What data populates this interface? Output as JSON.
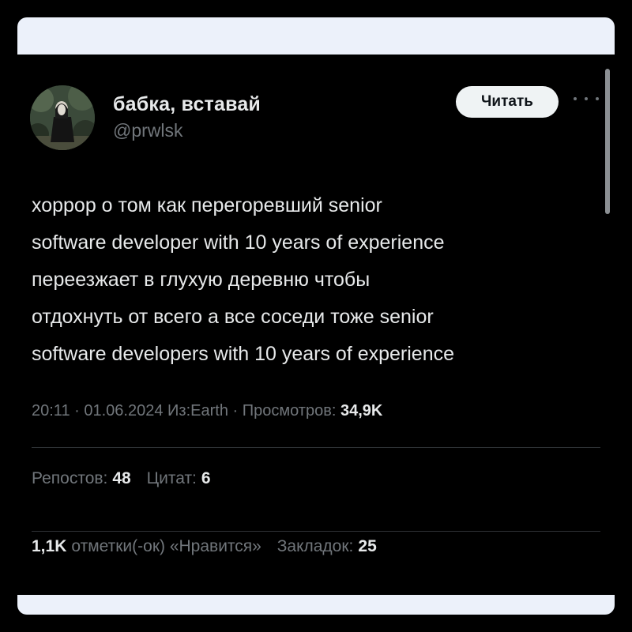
{
  "author": {
    "display_name": "бабка, вставай",
    "handle": "@prwlsk"
  },
  "follow_button": {
    "label": "Читать"
  },
  "tweet": {
    "text": "хоррор о том как перегоревший senior\nsoftware developer with 10 years of experience\nпереезжает в глухую деревню чтобы\nотдохнуть от всего а все соседи тоже senior\nsoftware developers with 10 years of experience"
  },
  "meta": {
    "time": "20:11",
    "date": "01.06.2024",
    "source": "Из:Earth",
    "views_label": "Просмотров:",
    "views_value": "34,9K",
    "separator": "·"
  },
  "stats_row1": {
    "reposts_label": "Репостов:",
    "reposts_value": "48",
    "quotes_label": "Цитат:",
    "quotes_value": "6"
  },
  "stats_row2": {
    "likes_value": "1,1K",
    "likes_label": "отметки(-ок) «Нравится»",
    "bookmarks_label": "Закладок:",
    "bookmarks_value": "25"
  },
  "icons": {
    "more": "more-horizontal-icon"
  },
  "colors": {
    "background": "#000000",
    "frame": "#ecf1fa",
    "text_primary": "#e7e9ea",
    "text_secondary": "#71767b",
    "button_bg": "#eff3f4",
    "divider": "#2f3336"
  }
}
